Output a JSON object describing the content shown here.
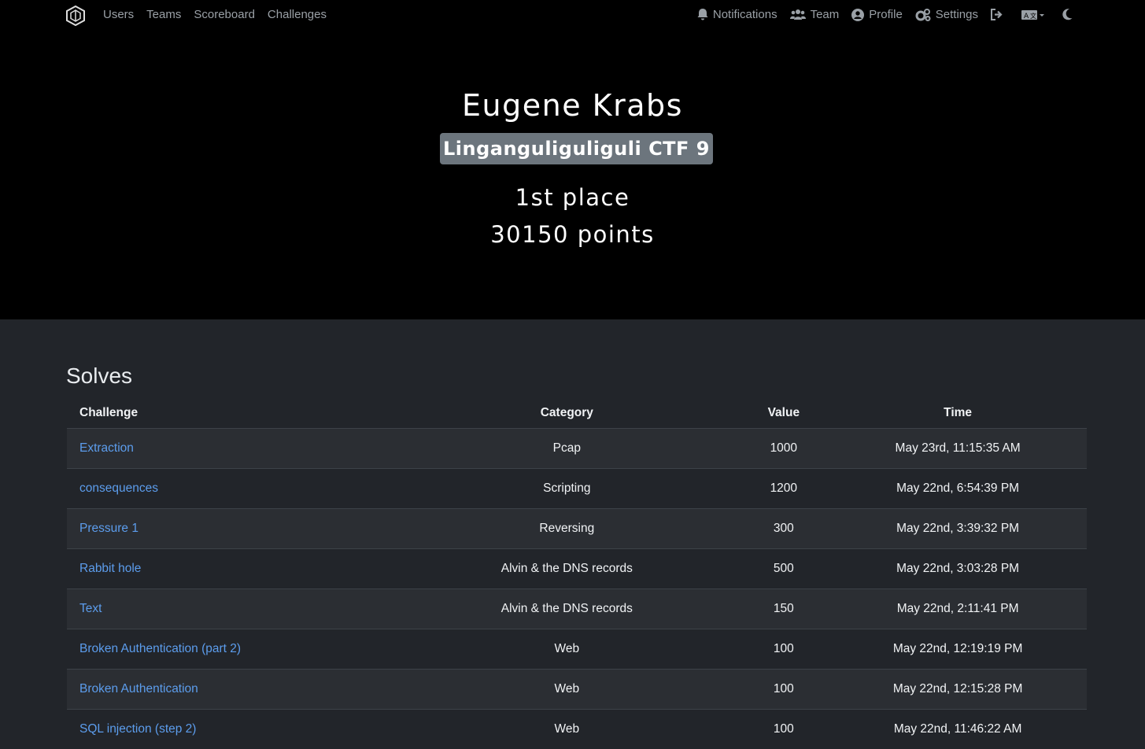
{
  "nav": {
    "left": [
      "Users",
      "Teams",
      "Scoreboard",
      "Challenges"
    ],
    "notifications": "Notifications",
    "team": "Team",
    "profile": "Profile",
    "settings": "Settings"
  },
  "user": {
    "name": "Eugene Krabs",
    "team": "Linganguliguliguli CTF 9",
    "place": "1st place",
    "points": "30150 points"
  },
  "solves": {
    "title": "Solves",
    "headers": [
      "Challenge",
      "Category",
      "Value",
      "Time"
    ],
    "rows": [
      {
        "challenge": "Extraction",
        "category": "Pcap",
        "value": "1000",
        "time": "May 23rd, 11:15:35 AM"
      },
      {
        "challenge": "consequences",
        "category": "Scripting",
        "value": "1200",
        "time": "May 22nd, 6:54:39 PM"
      },
      {
        "challenge": "Pressure 1",
        "category": "Reversing",
        "value": "300",
        "time": "May 22nd, 3:39:32 PM"
      },
      {
        "challenge": "Rabbit hole",
        "category": "Alvin & the DNS records",
        "value": "500",
        "time": "May 22nd, 3:03:28 PM"
      },
      {
        "challenge": "Text",
        "category": "Alvin & the DNS records",
        "value": "150",
        "time": "May 22nd, 2:11:41 PM"
      },
      {
        "challenge": "Broken Authentication (part 2)",
        "category": "Web",
        "value": "100",
        "time": "May 22nd, 12:19:19 PM"
      },
      {
        "challenge": "Broken Authentication",
        "category": "Web",
        "value": "100",
        "time": "May 22nd, 12:15:28 PM"
      },
      {
        "challenge": "SQL injection (step 2)",
        "category": "Web",
        "value": "100",
        "time": "May 22nd, 11:46:22 AM"
      }
    ]
  },
  "colors": {
    "accent": "#5c9ded",
    "badge": "#6c757d",
    "hero": "#000000",
    "page": "#22252a"
  }
}
